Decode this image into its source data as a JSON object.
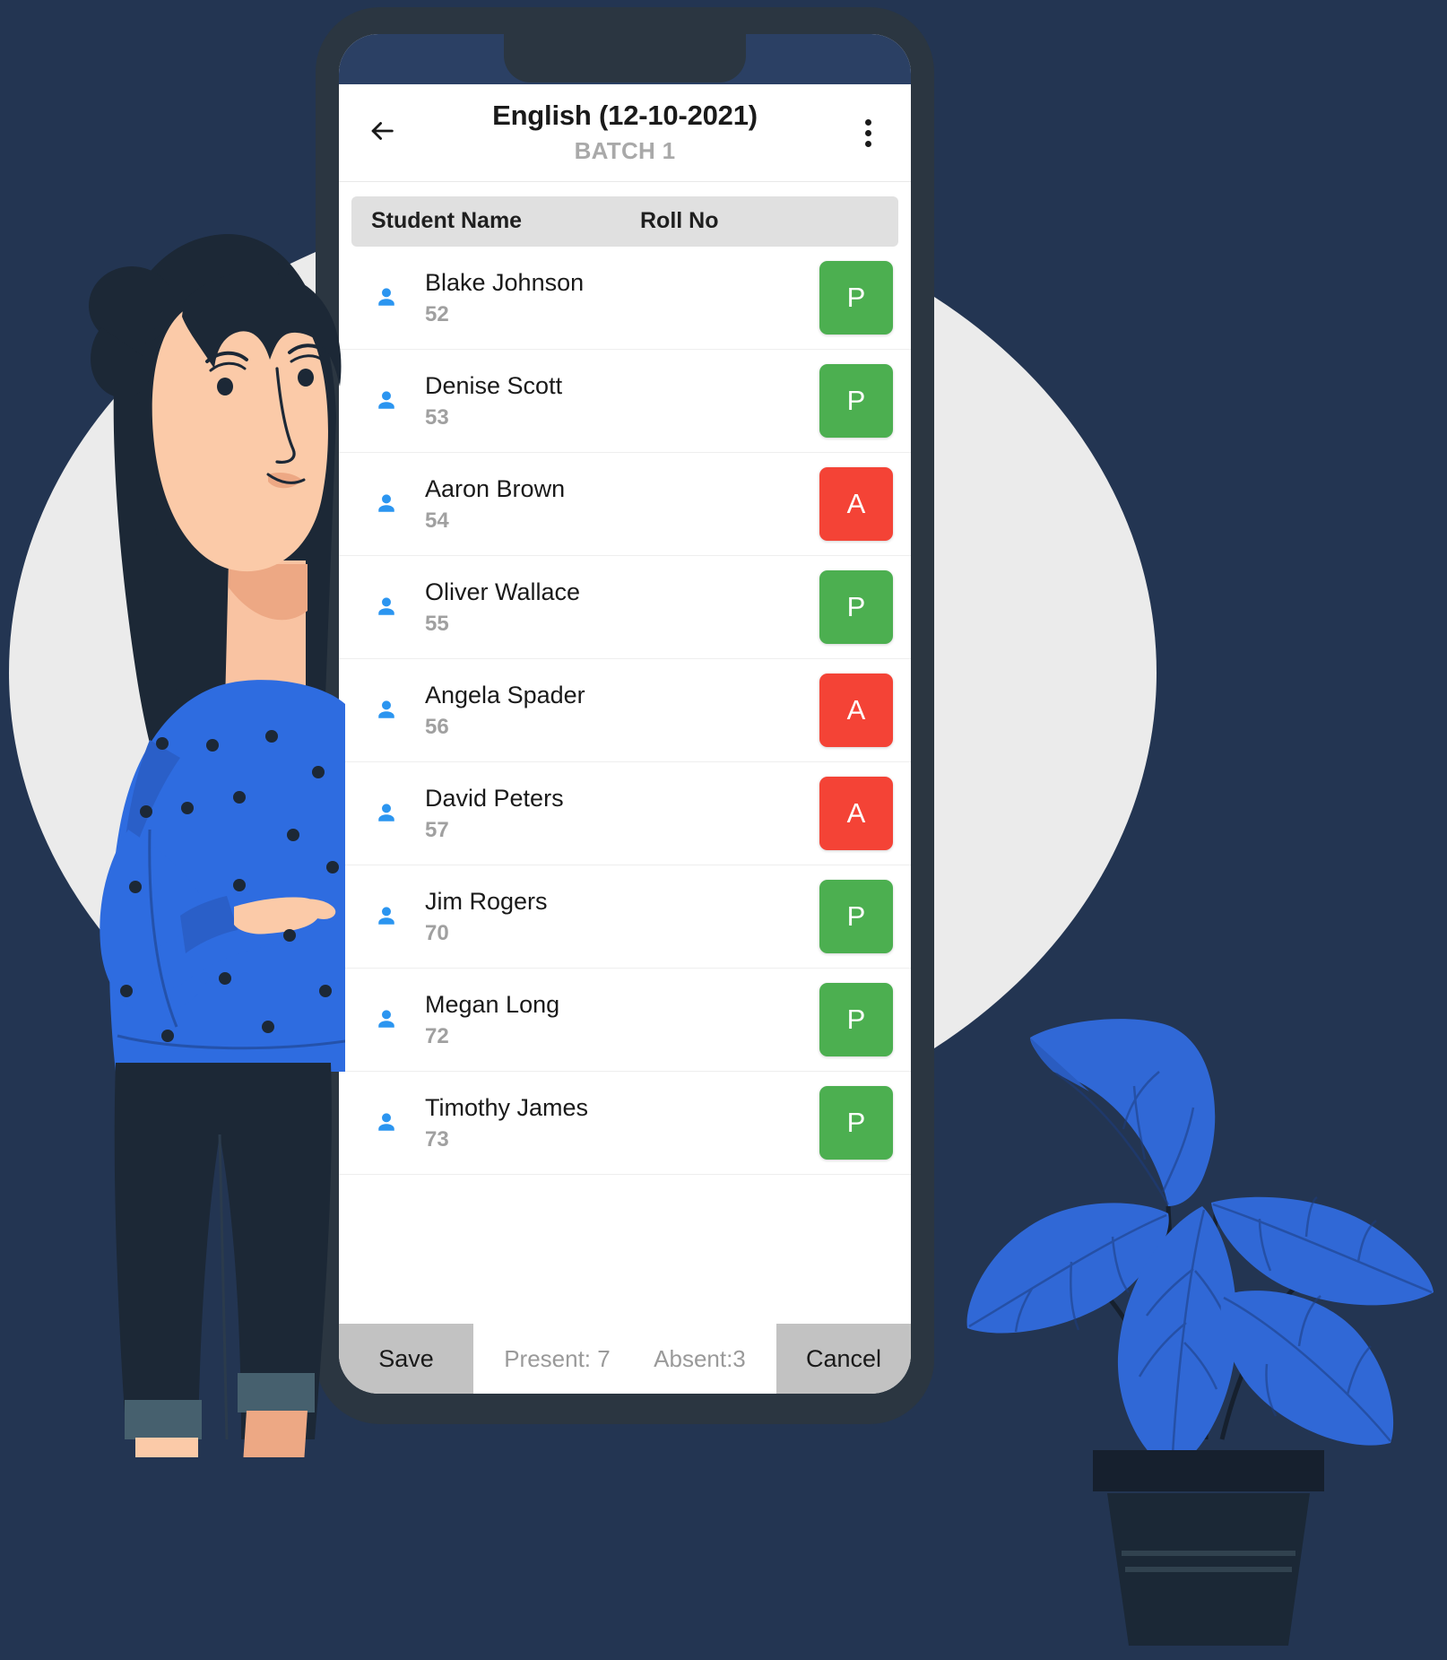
{
  "theme": {
    "background": "#233552",
    "phone_frame": "#2b3641",
    "status_bar": "#2b4064",
    "accent_blue": "#2e6ce0",
    "present_color": "#4CAF50",
    "absent_color": "#F44336",
    "backdrop_circle": "#EBEBEB"
  },
  "appbar": {
    "back_icon": "arrow-left-icon",
    "title": "English (12-10-2021)",
    "subtitle": "BATCH 1",
    "menu_icon": "more-vertical-icon"
  },
  "table": {
    "columns": [
      "Student Name",
      "Roll No"
    ]
  },
  "students": [
    {
      "icon": "person-icon",
      "name": "Blake Johnson",
      "roll": "52",
      "status": "P",
      "status_label": "Present"
    },
    {
      "icon": "person-icon",
      "name": "Denise Scott",
      "roll": "53",
      "status": "P",
      "status_label": "Present"
    },
    {
      "icon": "person-icon",
      "name": "Aaron Brown",
      "roll": "54",
      "status": "A",
      "status_label": "Absent"
    },
    {
      "icon": "person-icon",
      "name": "Oliver Wallace",
      "roll": "55",
      "status": "P",
      "status_label": "Present"
    },
    {
      "icon": "person-icon",
      "name": "Angela Spader",
      "roll": "56",
      "status": "A",
      "status_label": "Absent"
    },
    {
      "icon": "person-icon",
      "name": "David Peters",
      "roll": "57",
      "status": "A",
      "status_label": "Absent"
    },
    {
      "icon": "person-icon",
      "name": "Jim Rogers",
      "roll": "70",
      "status": "P",
      "status_label": "Present"
    },
    {
      "icon": "person-icon",
      "name": "Megan Long",
      "roll": "72",
      "status": "P",
      "status_label": "Present"
    },
    {
      "icon": "person-icon",
      "name": "Timothy James",
      "roll": "73",
      "status": "P",
      "status_label": "Present"
    }
  ],
  "bottombar": {
    "save_label": "Save",
    "present_label": "Present: 7",
    "absent_label": "Absent:3",
    "cancel_label": "Cancel"
  }
}
